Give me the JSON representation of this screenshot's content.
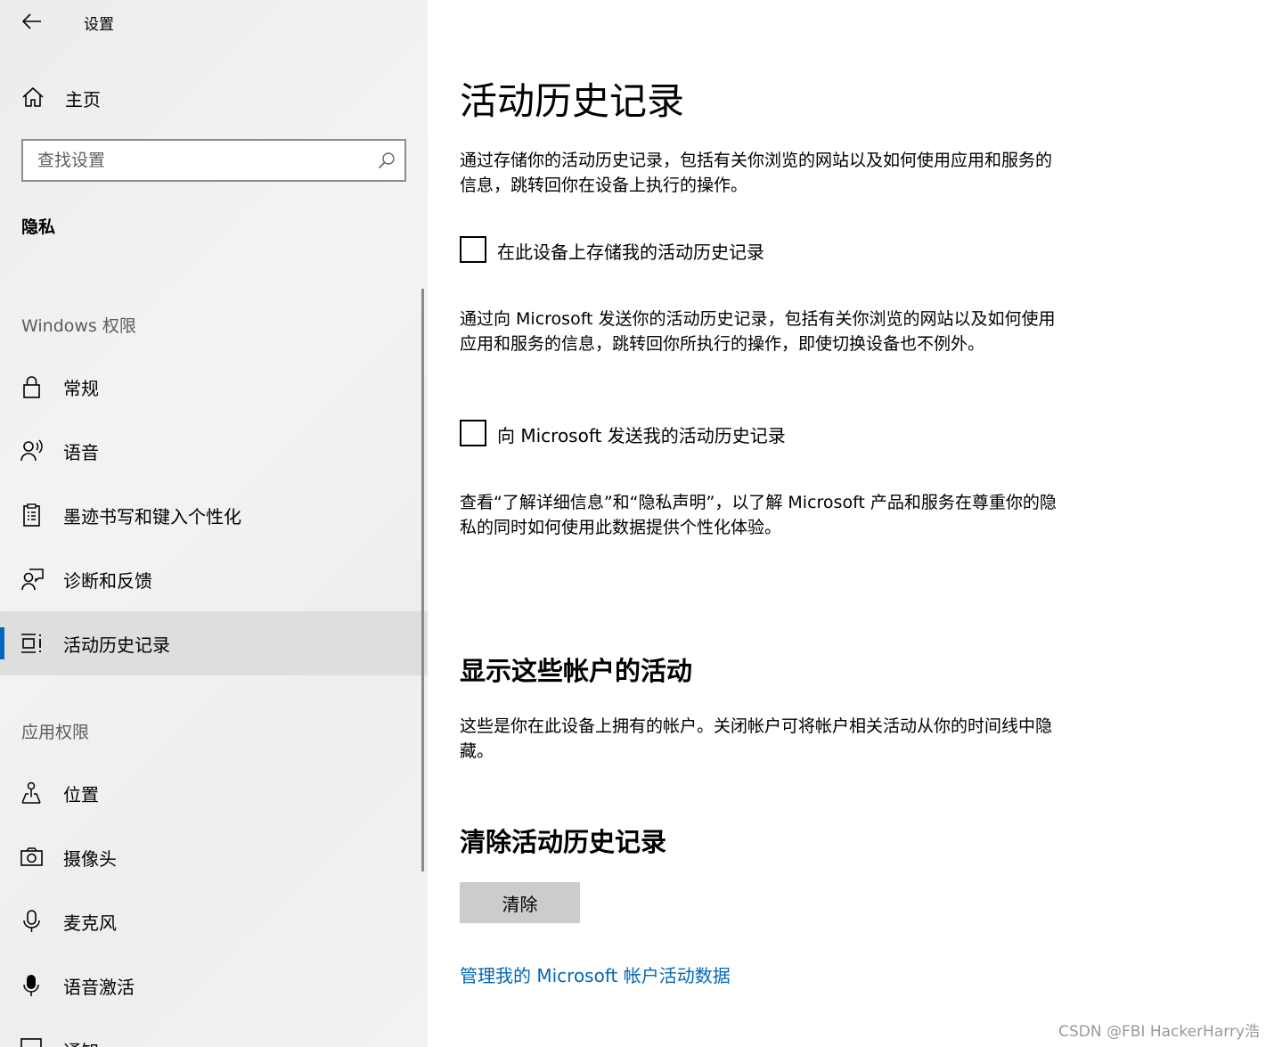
{
  "window": {
    "title": "设置"
  },
  "sidebar": {
    "home_label": "主页",
    "search_placeholder": "查找设置",
    "section_title": "隐私",
    "windows_group_label": "Windows 权限",
    "windows_items": [
      {
        "label": "常规",
        "icon": "lock-icon"
      },
      {
        "label": "语音",
        "icon": "speech-icon"
      },
      {
        "label": "墨迹书写和键入个性化",
        "icon": "clipboard-icon"
      },
      {
        "label": "诊断和反馈",
        "icon": "feedback-icon"
      },
      {
        "label": "活动历史记录",
        "icon": "activity-history-icon",
        "selected": true
      }
    ],
    "app_group_label": "应用权限",
    "app_items": [
      {
        "label": "位置",
        "icon": "location-icon"
      },
      {
        "label": "摄像头",
        "icon": "camera-icon"
      },
      {
        "label": "麦克风",
        "icon": "microphone-icon"
      },
      {
        "label": "语音激活",
        "icon": "voice-activation-icon"
      },
      {
        "label": "通知",
        "icon": "notification-icon"
      }
    ]
  },
  "main": {
    "title": "活动历史记录",
    "para1": "通过存储你的活动历史记录，包括有关你浏览的网站以及如何使用应用和服务的信息，跳转回你在设备上执行的操作。",
    "checkbox1_label": "在此设备上存储我的活动历史记录",
    "checkbox1_checked": false,
    "para2": "通过向 Microsoft 发送你的活动历史记录，包括有关你浏览的网站以及如何使用应用和服务的信息，跳转回你所执行的操作，即使切换设备也不例外。",
    "checkbox2_label": "向 Microsoft 发送我的活动历史记录",
    "checkbox2_checked": false,
    "para3": "查看“了解详细信息”和“隐私声明”，以了解 Microsoft 产品和服务在尊重你的隐私的同时如何使用此数据提供个性化体验。",
    "accounts_title": "显示这些帐户的活动",
    "accounts_desc": "这些是你在此设备上拥有的帐户。关闭帐户可将帐户相关活动从你的时间线中隐藏。",
    "clear_title": "清除活动历史记录",
    "clear_button": "清除",
    "manage_link": "管理我的 Microsoft 帐户活动数据"
  },
  "watermark": "CSDN @FBI HackerHarry浩",
  "colors": {
    "accent": "#0067c0",
    "link": "#0067b8",
    "button": "#cccccc",
    "selected_bg": "#dedede"
  }
}
